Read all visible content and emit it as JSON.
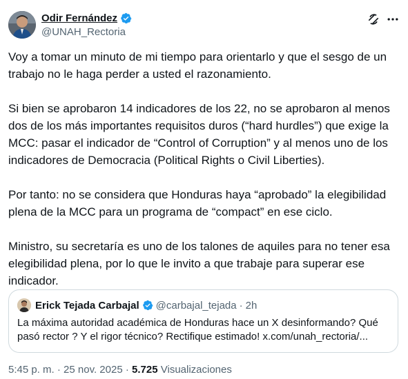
{
  "author": {
    "name": "Odir Fernández",
    "handle": "@UNAH_Rectoria"
  },
  "tweet": {
    "paragraphs": [
      "Voy a tomar un minuto de mi tiempo para orientarlo y que el sesgo de un trabajo no le haga perder a usted el razonamiento.",
      "Si bien se aprobaron 14 indicadores de los 22, no se aprobaron al menos dos de los más importantes  requisitos duros (“hard hurdles”) que exige la MCC: pasar el indicador de “Control of Corruption” y al menos uno de los indicadores de Democracia (Political Rights o Civil Liberties).",
      "Por tanto: no se considera que Honduras haya “aprobado” la elegibilidad plena de la MCC para un programa de “compact” en ese ciclo.",
      "Ministro, su secretaría es uno de los talones de aquiles para no tener esa elegibilidad plena, por lo que le invito a que trabaje para superar ese indicador."
    ]
  },
  "quote": {
    "name": "Erick Tejada Carbajal",
    "handle": "@carbajal_tejada",
    "separator": "·",
    "time": "2h",
    "text": "La máxima autoridad académica de Honduras hace un X  desinformando? Qué pasó rector ? Y el rigor técnico? Rectifique estimado! x.com/unah_rectoria/..."
  },
  "footer": {
    "time": "5:45 p. m.",
    "separator1": "·",
    "date": "25 nov. 2025",
    "separator2": "·",
    "views_count": "5.725",
    "views_label": "Visualizaciones"
  },
  "icons": {
    "verified": "verified-badge-icon",
    "grok": "grok-icon",
    "more": "more-options-icon"
  },
  "colors": {
    "verified_blue": "#1d9bf0",
    "text_primary": "#0f1419",
    "text_secondary": "#536471",
    "border": "#cfd9de"
  }
}
